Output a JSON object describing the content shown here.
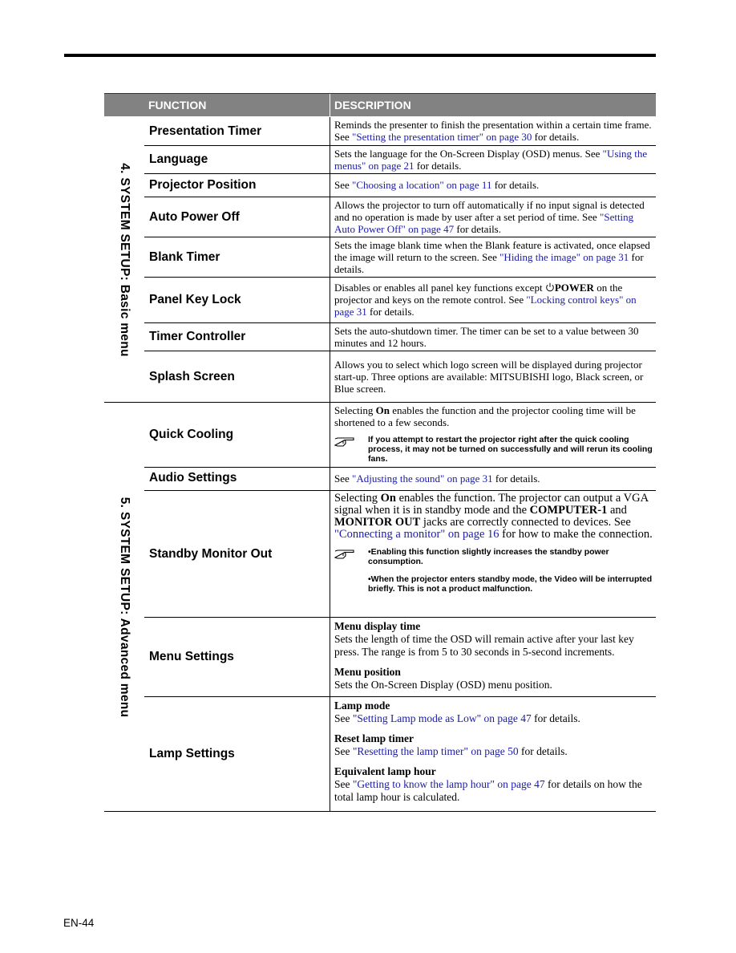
{
  "header": {
    "function_label": "FUNCTION",
    "description_label": "DESCRIPTION"
  },
  "sections": {
    "basic": {
      "title": "4. SYSTEM SETUP: Basic menu",
      "rows": {
        "presentation_timer": {
          "name": "Presentation Timer",
          "t1": "Reminds the presenter to finish the presentation within a certain time frame. See ",
          "link": "\"Setting the presentation timer\" on page 30",
          "t2": " for details."
        },
        "language": {
          "name": "Language",
          "t1": "Sets the language for the On-Screen Display (OSD) menus. See ",
          "link": "\"Using the menus\" on page 21",
          "t2": " for details."
        },
        "projector_position": {
          "name": "Projector Position",
          "t1": "See ",
          "link": "\"Choosing a location\" on page 11",
          "t2": " for details."
        },
        "auto_power_off": {
          "name": "Auto Power Off",
          "t1": "Allows the projector to turn off automatically if no input signal is detected and no operation is made by user after a set period of time. See ",
          "link": "\"Setting Auto Power Off\" on page 47",
          "t2": " for details."
        },
        "blank_timer": {
          "name": "Blank Timer",
          "t1": "Sets the image blank time when the Blank feature is activated, once elapsed the image will return to the screen. See ",
          "link": "\"Hiding the image\" on page 31",
          "t2": " for details."
        },
        "panel_key_lock": {
          "name": "Panel Key Lock",
          "t1": "Disables or enables all panel key functions except ",
          "icon": "power-icon",
          "kw": "POWER",
          "t2": " on the projector and keys on the remote control. See ",
          "link": "\"Locking control keys\" on page 31",
          "t3": " for details."
        },
        "timer_controller": {
          "name": "Timer Controller",
          "t1": "Sets the auto-shutdown timer. The timer can be set to a value between 30 minutes and 12 hours."
        },
        "splash_screen": {
          "name": "Splash Screen",
          "t1": "Allows you to select which logo screen will be displayed during projector start-up. Three options are available: MITSUBISHI logo, Black screen, or Blue screen."
        }
      }
    },
    "advanced": {
      "title": "5. SYSTEM SETUP: Advanced menu",
      "rows": {
        "quick_cooling": {
          "name": "Quick Cooling",
          "t1": "Selecting ",
          "kw": "On",
          "t2": " enables the function and the projector cooling time will be shortened to a few seconds.",
          "note_icon": "hand-pointer-icon",
          "note": "If you attempt to restart the projector right after the quick cooling process, it may not be turned on successfully and will rerun its cooling fans."
        },
        "audio_settings": {
          "name": "Audio Settings",
          "t1": "See ",
          "link": "\"Adjusting the sound\" on page 31",
          "t2": " for details."
        },
        "standby_monitor_out": {
          "name": "Standby Monitor Out",
          "t1": "Selecting ",
          "kw1": "On",
          "t2": " enables the function. The projector can output a VGA signal when it is in standby mode and the ",
          "kw2": "COMPUTER-1",
          "t3": " and ",
          "kw3": "MONITOR OUT",
          "t4": " jacks are correctly connected to devices. See ",
          "link": "\"Connecting a monitor\" on page 16",
          "t5": " for how to make the connection.",
          "note_icon": "hand-pointer-icon",
          "notes": [
            "•Enabling this function slightly increases the standby power consumption.",
            "•When the projector enters standby mode, the Video will be interrupted briefly. This is not a product malfunction."
          ]
        },
        "menu_settings": {
          "name": "Menu Settings",
          "items": [
            {
              "heading": "Menu display time",
              "text": "Sets the length of time the OSD will remain active after your last key press. The range is from 5 to 30 seconds in 5-second increments."
            },
            {
              "heading": "Menu position",
              "text": "Sets the On-Screen Display (OSD) menu position."
            }
          ]
        },
        "lamp_settings": {
          "name": "Lamp Settings",
          "items": [
            {
              "heading": "Lamp mode",
              "t1": "See ",
              "link": "\"Setting Lamp mode as Low\" on page 47",
              "t2": " for details."
            },
            {
              "heading": "Reset lamp timer",
              "t1": "See ",
              "link": "\"Resetting the lamp timer\" on page 50",
              "t2": " for details."
            },
            {
              "heading": "Equivalent lamp hour",
              "t1": "See ",
              "link": "\"Getting to know the lamp hour\" on page 47",
              "t2": " for details on how the total lamp hour is calculated."
            }
          ]
        }
      }
    }
  },
  "footer": {
    "page_number": "EN-44"
  },
  "colors": {
    "header_bg": "#828282",
    "link": "#1a1aa8",
    "rule": "#000000"
  }
}
